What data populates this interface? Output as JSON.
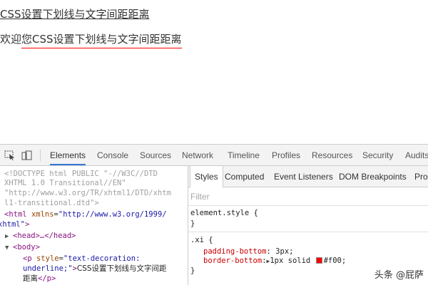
{
  "page": {
    "line1": "CSS设置下划线与文字间距距离",
    "line2_prefix": "欢迎",
    "line2_underlined": "您CSS设置下划线与文字间距距离"
  },
  "devtools": {
    "tabs": [
      "Elements",
      "Console",
      "Sources",
      "Network",
      "Timeline",
      "Profiles",
      "Resources",
      "Security",
      "Audits"
    ],
    "active_tab": "Elements",
    "icons": [
      "inspect-icon",
      "device-mode-icon"
    ],
    "elements": {
      "doctype": [
        "<!DOCTYPE html PUBLIC \"-//W3C//DTD",
        "XHTML 1.0 Transitional//EN\"",
        "\"http://www.w3.org/TR/xhtml1/DTD/xhtm",
        "l1-transitional.dtd\">"
      ],
      "html_open": "<html",
      "html_attr": "xmlns",
      "html_eq": "=",
      "html_val": "\"http://www.w3.org/1999/",
      "html_val_cont": "xhtml\"",
      "html_close_bracket": ">",
      "head": "<head>…</head>",
      "body": "<body>",
      "p_open": "<p",
      "p_attr": "style",
      "p_eq": "=",
      "p_val_1": "\"text-decoration:",
      "p_val_2": "underline;\"",
      "p_gt": ">",
      "p_text": "CSS设置下划线与文字间距",
      "p_text_cont": "距离",
      "p_close": "</p>"
    },
    "styles": {
      "tabs": [
        "Styles",
        "Computed",
        "Event Listeners",
        "DOM Breakpoints",
        "Prop"
      ],
      "active_tab": "Styles",
      "filter_placeholder": "Filter",
      "rules": [
        {
          "selector": "element.style {",
          "close": "}"
        },
        {
          "selector": ".xi {",
          "properties": [
            {
              "name": "padding-bottom",
              "value": "3px;"
            },
            {
              "name": "border-bottom",
              "value_prefix": "1px solid",
              "color": "#ff0000",
              "value_suffix": "#f00;"
            }
          ],
          "close": "}"
        }
      ]
    }
  },
  "watermark": "头条 @屁萨",
  "colors": {
    "accent": "#3879d9",
    "underline_red": "#ff0000"
  }
}
